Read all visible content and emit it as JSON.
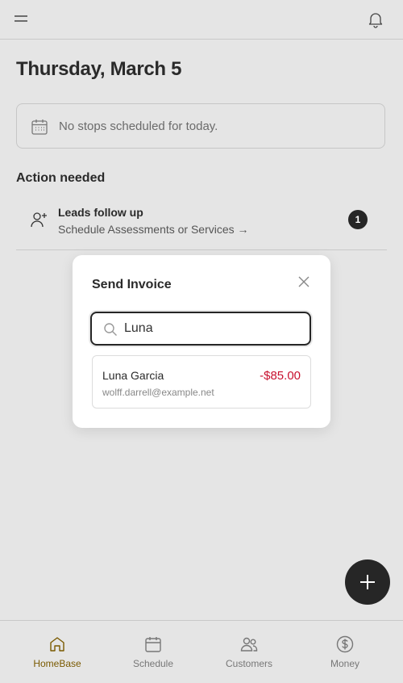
{
  "header": {
    "menu_icon": "menu-icon",
    "bell_icon": "bell-icon"
  },
  "main": {
    "date_title": "Thursday, March 5",
    "no_stops_text": "No stops scheduled for today.",
    "action_heading": "Action needed",
    "lead": {
      "title": "Leads follow up",
      "subtitle": "Schedule Assessments or Services →",
      "count": "1"
    }
  },
  "modal": {
    "title": "Send Invoice",
    "search_value": "Luna",
    "results": [
      {
        "name": "Luna Garcia",
        "email": "wolff.darrell@example.net",
        "amount": "-$85.00"
      }
    ]
  },
  "nav": {
    "items": [
      {
        "label": "HomeBase",
        "icon": "home-icon",
        "active": true
      },
      {
        "label": "Schedule",
        "icon": "calendar-icon",
        "active": false
      },
      {
        "label": "Customers",
        "icon": "customers-icon",
        "active": false
      },
      {
        "label": "Money",
        "icon": "dollar-icon",
        "active": false
      }
    ]
  },
  "colors": {
    "background": "#e5e5e5",
    "accent_active": "#7a5a00",
    "negative_amount": "#c8102e",
    "dark": "#262626"
  }
}
